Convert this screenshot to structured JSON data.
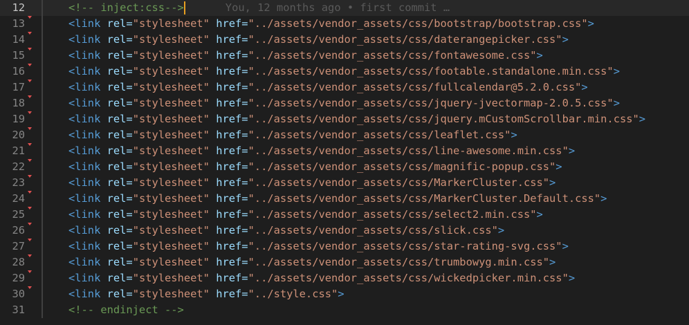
{
  "editor": {
    "lines": [
      {
        "number": "12",
        "kind": "comment",
        "text": "<!-- inject:css-->",
        "blame": "You, 12 months ago • first commit …",
        "current": true
      },
      {
        "number": "13",
        "kind": "link",
        "tag": "<link",
        "attr1": "rel=",
        "val1": "\"stylesheet\"",
        "attr2": "href=",
        "val2": "\"../assets/vendor_assets/css/bootstrap/bootstrap.css\"",
        "close": ">"
      },
      {
        "number": "14",
        "kind": "link",
        "tag": "<link",
        "attr1": "rel=",
        "val1": "\"stylesheet\"",
        "attr2": "href=",
        "val2": "\"../assets/vendor_assets/css/daterangepicker.css\"",
        "close": ">"
      },
      {
        "number": "15",
        "kind": "link",
        "tag": "<link",
        "attr1": "rel=",
        "val1": "\"stylesheet\"",
        "attr2": "href=",
        "val2": "\"../assets/vendor_assets/css/fontawesome.css\"",
        "close": ">"
      },
      {
        "number": "16",
        "kind": "link",
        "tag": "<link",
        "attr1": "rel=",
        "val1": "\"stylesheet\"",
        "attr2": "href=",
        "val2": "\"../assets/vendor_assets/css/footable.standalone.min.css\"",
        "close": ">"
      },
      {
        "number": "17",
        "kind": "link",
        "tag": "<link",
        "attr1": "rel=",
        "val1": "\"stylesheet\"",
        "attr2": "href=",
        "val2": "\"../assets/vendor_assets/css/fullcalendar@5.2.0.css\"",
        "close": ">"
      },
      {
        "number": "18",
        "kind": "link",
        "tag": "<link",
        "attr1": "rel=",
        "val1": "\"stylesheet\"",
        "attr2": "href=",
        "val2": "\"../assets/vendor_assets/css/jquery-jvectormap-2.0.5.css\"",
        "close": ">"
      },
      {
        "number": "19",
        "kind": "link",
        "tag": "<link",
        "attr1": "rel=",
        "val1": "\"stylesheet\"",
        "attr2": "href=",
        "val2": "\"../assets/vendor_assets/css/jquery.mCustomScrollbar.min.css\"",
        "close": ">"
      },
      {
        "number": "20",
        "kind": "link",
        "tag": "<link",
        "attr1": "rel=",
        "val1": "\"stylesheet\"",
        "attr2": "href=",
        "val2": "\"../assets/vendor_assets/css/leaflet.css\"",
        "close": ">"
      },
      {
        "number": "21",
        "kind": "link",
        "tag": "<link",
        "attr1": "rel=",
        "val1": "\"stylesheet\"",
        "attr2": "href=",
        "val2": "\"../assets/vendor_assets/css/line-awesome.min.css\"",
        "close": ">"
      },
      {
        "number": "22",
        "kind": "link",
        "tag": "<link",
        "attr1": "rel=",
        "val1": "\"stylesheet\"",
        "attr2": "href=",
        "val2": "\"../assets/vendor_assets/css/magnific-popup.css\"",
        "close": ">"
      },
      {
        "number": "23",
        "kind": "link",
        "tag": "<link",
        "attr1": "rel=",
        "val1": "\"stylesheet\"",
        "attr2": "href=",
        "val2": "\"../assets/vendor_assets/css/MarkerCluster.css\"",
        "close": ">"
      },
      {
        "number": "24",
        "kind": "link",
        "tag": "<link",
        "attr1": "rel=",
        "val1": "\"stylesheet\"",
        "attr2": "href=",
        "val2": "\"../assets/vendor_assets/css/MarkerCluster.Default.css\"",
        "close": ">"
      },
      {
        "number": "25",
        "kind": "link",
        "tag": "<link",
        "attr1": "rel=",
        "val1": "\"stylesheet\"",
        "attr2": "href=",
        "val2": "\"../assets/vendor_assets/css/select2.min.css\"",
        "close": ">"
      },
      {
        "number": "26",
        "kind": "link",
        "tag": "<link",
        "attr1": "rel=",
        "val1": "\"stylesheet\"",
        "attr2": "href=",
        "val2": "\"../assets/vendor_assets/css/slick.css\"",
        "close": ">"
      },
      {
        "number": "27",
        "kind": "link",
        "tag": "<link",
        "attr1": "rel=",
        "val1": "\"stylesheet\"",
        "attr2": "href=",
        "val2": "\"../assets/vendor_assets/css/star-rating-svg.css\"",
        "close": ">"
      },
      {
        "number": "28",
        "kind": "link",
        "tag": "<link",
        "attr1": "rel=",
        "val1": "\"stylesheet\"",
        "attr2": "href=",
        "val2": "\"../assets/vendor_assets/css/trumbowyg.min.css\"",
        "close": ">"
      },
      {
        "number": "29",
        "kind": "link",
        "tag": "<link",
        "attr1": "rel=",
        "val1": "\"stylesheet\"",
        "attr2": "href=",
        "val2": "\"../assets/vendor_assets/css/wickedpicker.min.css\"",
        "close": ">"
      },
      {
        "number": "30",
        "kind": "link",
        "tag": "<link",
        "attr1": "rel=",
        "val1": "\"stylesheet\"",
        "attr2": "href=",
        "val2": "\"../style.css\"",
        "close": ">"
      },
      {
        "number": "31",
        "kind": "comment",
        "text": "<!-- endinject -->"
      }
    ]
  },
  "colors": {
    "background": "#1e1e1e",
    "current_line": "#282828",
    "line_number": "#858585",
    "tag": "#569cd6",
    "attribute": "#9cdcfe",
    "string": "#ce9178",
    "comment": "#6a9955",
    "cursor": "#e8a020",
    "change_marker": "#e05050"
  }
}
